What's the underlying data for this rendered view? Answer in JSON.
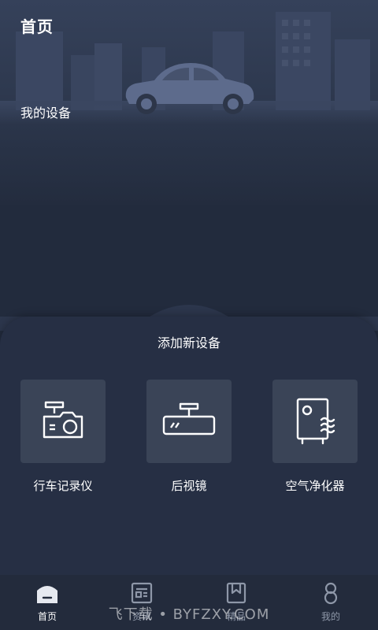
{
  "header": {
    "title": "首页"
  },
  "devices_section": {
    "title": "我的设备"
  },
  "add_panel": {
    "title": "添加新设备",
    "devices": [
      {
        "label": "行车记录仪",
        "icon": "dashcam-icon"
      },
      {
        "label": "后视镜",
        "icon": "rearview-mirror-icon"
      },
      {
        "label": "空气净化器",
        "icon": "air-purifier-icon"
      }
    ]
  },
  "tabbar": {
    "tabs": [
      {
        "label": "首页",
        "icon": "home-icon",
        "active": true
      },
      {
        "label": "资讯",
        "icon": "news-icon",
        "active": false
      },
      {
        "label": "精品",
        "icon": "bookmark-icon",
        "active": false
      },
      {
        "label": "我的",
        "icon": "profile-icon",
        "active": false
      }
    ]
  },
  "watermark": {
    "text": "飞下载 • BYFZXY.COM"
  },
  "colors": {
    "background": "#222b3d",
    "tile": "#3a4457",
    "tab_inactive": "#8e97a8",
    "text": "#ffffff"
  }
}
